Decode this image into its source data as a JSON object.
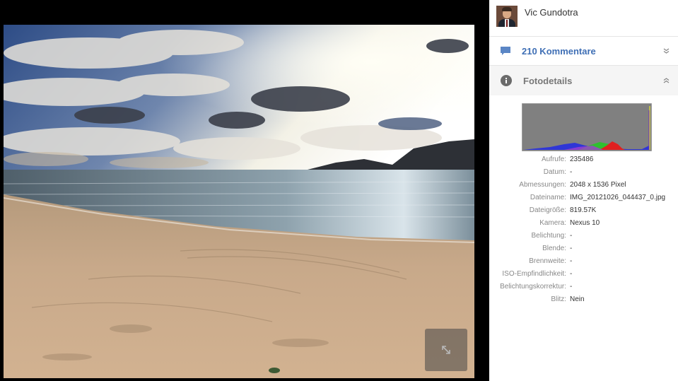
{
  "author": {
    "name": "Vic Gundotra"
  },
  "comments": {
    "label": "210 Kommentare"
  },
  "photo_details": {
    "label": "Fotodetails",
    "rows": [
      {
        "key": "Aufrufe:",
        "value": "235486"
      },
      {
        "key": "Datum:",
        "value": "-"
      },
      {
        "key": "Abmessungen:",
        "value": "2048 x 1536 Pixel"
      },
      {
        "key": "Dateiname:",
        "value": "IMG_20121026_044437_0.jpg"
      },
      {
        "key": "Dateigröße:",
        "value": "819.57K"
      },
      {
        "key": "Kamera:",
        "value": "Nexus 10"
      },
      {
        "key": "Belichtung:",
        "value": "-"
      },
      {
        "key": "Blende:",
        "value": "-"
      },
      {
        "key": "Brennweite:",
        "value": "-"
      },
      {
        "key": "ISO-Empfindlichkeit:",
        "value": "-"
      },
      {
        "key": "Belichtungskorrektur:",
        "value": "-"
      },
      {
        "key": "Blitz:",
        "value": "Nein"
      }
    ]
  },
  "icons": {
    "comment": "comment-icon",
    "info": "info-icon",
    "collapse": "chevron-double-up-icon",
    "expand": "chevron-double-down-icon",
    "fullscreen": "expand-arrows-icon"
  },
  "colors": {
    "link_blue": "#3f6fb5",
    "histogram_bg": "#808080"
  }
}
